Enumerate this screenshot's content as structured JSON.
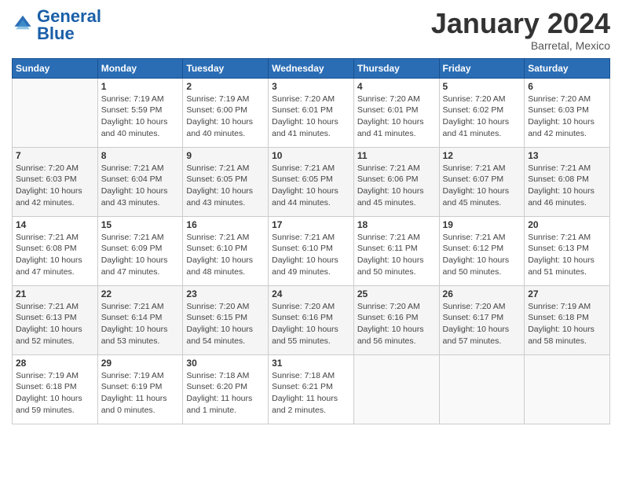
{
  "header": {
    "logo_line1": "General",
    "logo_line2": "Blue",
    "month": "January 2024",
    "location": "Barretal, Mexico"
  },
  "days_of_week": [
    "Sunday",
    "Monday",
    "Tuesday",
    "Wednesday",
    "Thursday",
    "Friday",
    "Saturday"
  ],
  "weeks": [
    [
      {
        "num": "",
        "info": ""
      },
      {
        "num": "1",
        "info": "Sunrise: 7:19 AM\nSunset: 5:59 PM\nDaylight: 10 hours\nand 40 minutes."
      },
      {
        "num": "2",
        "info": "Sunrise: 7:19 AM\nSunset: 6:00 PM\nDaylight: 10 hours\nand 40 minutes."
      },
      {
        "num": "3",
        "info": "Sunrise: 7:20 AM\nSunset: 6:01 PM\nDaylight: 10 hours\nand 41 minutes."
      },
      {
        "num": "4",
        "info": "Sunrise: 7:20 AM\nSunset: 6:01 PM\nDaylight: 10 hours\nand 41 minutes."
      },
      {
        "num": "5",
        "info": "Sunrise: 7:20 AM\nSunset: 6:02 PM\nDaylight: 10 hours\nand 41 minutes."
      },
      {
        "num": "6",
        "info": "Sunrise: 7:20 AM\nSunset: 6:03 PM\nDaylight: 10 hours\nand 42 minutes."
      }
    ],
    [
      {
        "num": "7",
        "info": "Sunrise: 7:20 AM\nSunset: 6:03 PM\nDaylight: 10 hours\nand 42 minutes."
      },
      {
        "num": "8",
        "info": "Sunrise: 7:21 AM\nSunset: 6:04 PM\nDaylight: 10 hours\nand 43 minutes."
      },
      {
        "num": "9",
        "info": "Sunrise: 7:21 AM\nSunset: 6:05 PM\nDaylight: 10 hours\nand 43 minutes."
      },
      {
        "num": "10",
        "info": "Sunrise: 7:21 AM\nSunset: 6:05 PM\nDaylight: 10 hours\nand 44 minutes."
      },
      {
        "num": "11",
        "info": "Sunrise: 7:21 AM\nSunset: 6:06 PM\nDaylight: 10 hours\nand 45 minutes."
      },
      {
        "num": "12",
        "info": "Sunrise: 7:21 AM\nSunset: 6:07 PM\nDaylight: 10 hours\nand 45 minutes."
      },
      {
        "num": "13",
        "info": "Sunrise: 7:21 AM\nSunset: 6:08 PM\nDaylight: 10 hours\nand 46 minutes."
      }
    ],
    [
      {
        "num": "14",
        "info": "Sunrise: 7:21 AM\nSunset: 6:08 PM\nDaylight: 10 hours\nand 47 minutes."
      },
      {
        "num": "15",
        "info": "Sunrise: 7:21 AM\nSunset: 6:09 PM\nDaylight: 10 hours\nand 47 minutes."
      },
      {
        "num": "16",
        "info": "Sunrise: 7:21 AM\nSunset: 6:10 PM\nDaylight: 10 hours\nand 48 minutes."
      },
      {
        "num": "17",
        "info": "Sunrise: 7:21 AM\nSunset: 6:10 PM\nDaylight: 10 hours\nand 49 minutes."
      },
      {
        "num": "18",
        "info": "Sunrise: 7:21 AM\nSunset: 6:11 PM\nDaylight: 10 hours\nand 50 minutes."
      },
      {
        "num": "19",
        "info": "Sunrise: 7:21 AM\nSunset: 6:12 PM\nDaylight: 10 hours\nand 50 minutes."
      },
      {
        "num": "20",
        "info": "Sunrise: 7:21 AM\nSunset: 6:13 PM\nDaylight: 10 hours\nand 51 minutes."
      }
    ],
    [
      {
        "num": "21",
        "info": "Sunrise: 7:21 AM\nSunset: 6:13 PM\nDaylight: 10 hours\nand 52 minutes."
      },
      {
        "num": "22",
        "info": "Sunrise: 7:21 AM\nSunset: 6:14 PM\nDaylight: 10 hours\nand 53 minutes."
      },
      {
        "num": "23",
        "info": "Sunrise: 7:20 AM\nSunset: 6:15 PM\nDaylight: 10 hours\nand 54 minutes."
      },
      {
        "num": "24",
        "info": "Sunrise: 7:20 AM\nSunset: 6:16 PM\nDaylight: 10 hours\nand 55 minutes."
      },
      {
        "num": "25",
        "info": "Sunrise: 7:20 AM\nSunset: 6:16 PM\nDaylight: 10 hours\nand 56 minutes."
      },
      {
        "num": "26",
        "info": "Sunrise: 7:20 AM\nSunset: 6:17 PM\nDaylight: 10 hours\nand 57 minutes."
      },
      {
        "num": "27",
        "info": "Sunrise: 7:19 AM\nSunset: 6:18 PM\nDaylight: 10 hours\nand 58 minutes."
      }
    ],
    [
      {
        "num": "28",
        "info": "Sunrise: 7:19 AM\nSunset: 6:18 PM\nDaylight: 10 hours\nand 59 minutes."
      },
      {
        "num": "29",
        "info": "Sunrise: 7:19 AM\nSunset: 6:19 PM\nDaylight: 11 hours\nand 0 minutes."
      },
      {
        "num": "30",
        "info": "Sunrise: 7:18 AM\nSunset: 6:20 PM\nDaylight: 11 hours\nand 1 minute."
      },
      {
        "num": "31",
        "info": "Sunrise: 7:18 AM\nSunset: 6:21 PM\nDaylight: 11 hours\nand 2 minutes."
      },
      {
        "num": "",
        "info": ""
      },
      {
        "num": "",
        "info": ""
      },
      {
        "num": "",
        "info": ""
      }
    ]
  ]
}
